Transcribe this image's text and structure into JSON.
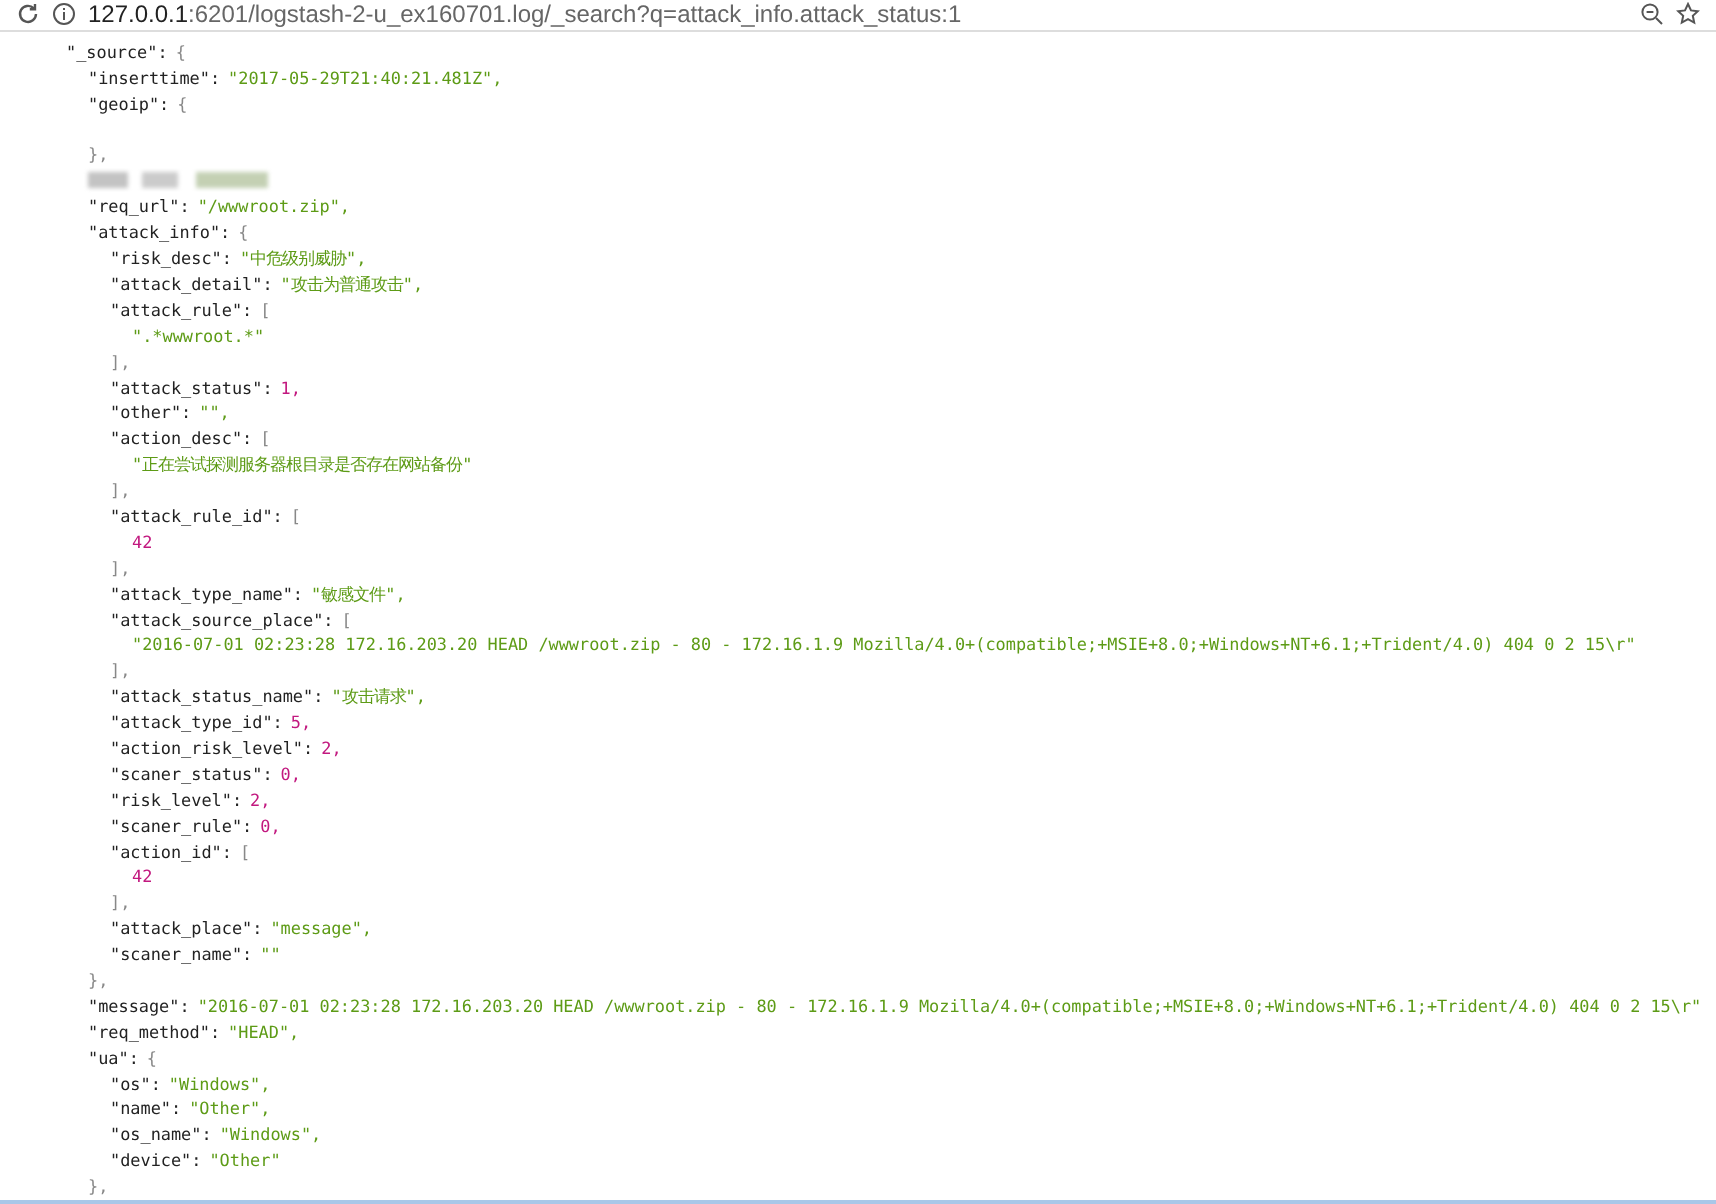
{
  "address_bar": {
    "host": "127.0.0.1",
    "path": ":6201/logstash-2-u_ex160701.log/_search?q=attack_info.attack_status:1"
  },
  "document": [
    {
      "kind": "object",
      "key": "\"_source\":",
      "open": "{",
      "children": [
        {
          "kind": "string",
          "key": "\"inserttime\":",
          "value": "\"2017-05-29T21:40:21.481Z\","
        },
        {
          "kind": "object",
          "key": "\"geoip\":",
          "open": "{",
          "close": "},",
          "children": [
            {
              "kind": "blank"
            }
          ]
        },
        {
          "kind": "redacted"
        },
        {
          "kind": "string",
          "key": "\"req_url\":",
          "value": "\"/wwwroot.zip\","
        },
        {
          "kind": "object",
          "key": "\"attack_info\":",
          "open": "{",
          "close": "},",
          "children": [
            {
              "kind": "string",
              "key": "\"risk_desc\":",
              "value": "\"中危级别威胁\","
            },
            {
              "kind": "string",
              "key": "\"attack_detail\":",
              "value": "\"攻击为普通攻击\","
            },
            {
              "kind": "object",
              "key": "\"attack_rule\":",
              "open": "[",
              "close": "],",
              "children": [
                {
                  "kind": "string",
                  "value": "\".*wwwroot.*\""
                }
              ]
            },
            {
              "kind": "number",
              "key": "\"attack_status\":",
              "value": "1,"
            },
            {
              "kind": "string",
              "key": "\"other\":",
              "value": "\"\","
            },
            {
              "kind": "object",
              "key": "\"action_desc\":",
              "open": "[",
              "close": "],",
              "children": [
                {
                  "kind": "string",
                  "value": "\"正在尝试探测服务器根目录是否存在网站备份\""
                }
              ]
            },
            {
              "kind": "object",
              "key": "\"attack_rule_id\":",
              "open": "[",
              "close": "],",
              "children": [
                {
                  "kind": "number",
                  "value": "42"
                }
              ]
            },
            {
              "kind": "string",
              "key": "\"attack_type_name\":",
              "value": "\"敏感文件\","
            },
            {
              "kind": "object",
              "key": "\"attack_source_place\":",
              "open": "[",
              "close": "],",
              "children": [
                {
                  "kind": "string",
                  "value": "\"2016-07-01 02:23:28 172.16.203.20 HEAD /wwwroot.zip - 80 - 172.16.1.9 Mozilla/4.0+(compatible;+MSIE+8.0;+Windows+NT+6.1;+Trident/4.0) 404 0 2 15\\r\""
                }
              ]
            },
            {
              "kind": "string",
              "key": "\"attack_status_name\":",
              "value": "\"攻击请求\","
            },
            {
              "kind": "number",
              "key": "\"attack_type_id\":",
              "value": "5,"
            },
            {
              "kind": "number",
              "key": "\"action_risk_level\":",
              "value": "2,"
            },
            {
              "kind": "number",
              "key": "\"scaner_status\":",
              "value": "0,"
            },
            {
              "kind": "number",
              "key": "\"risk_level\":",
              "value": "2,"
            },
            {
              "kind": "number",
              "key": "\"scaner_rule\":",
              "value": "0,"
            },
            {
              "kind": "object",
              "key": "\"action_id\":",
              "open": "[",
              "close": "],",
              "children": [
                {
                  "kind": "number",
                  "value": "42"
                }
              ]
            },
            {
              "kind": "string",
              "key": "\"attack_place\":",
              "value": "\"message\","
            },
            {
              "kind": "string",
              "key": "\"scaner_name\":",
              "value": "\"\""
            }
          ]
        },
        {
          "kind": "string",
          "key": "\"message\":",
          "value": "\"2016-07-01 02:23:28 172.16.203.20 HEAD /wwwroot.zip - 80 - 172.16.1.9 Mozilla/4.0+(compatible;+MSIE+8.0;+Windows+NT+6.1;+Trident/4.0) 404 0 2 15\\r\""
        },
        {
          "kind": "string",
          "key": "\"req_method\":",
          "value": "\"HEAD\","
        },
        {
          "kind": "object",
          "key": "\"ua\":",
          "open": "{",
          "close": "},",
          "children": [
            {
              "kind": "string",
              "key": "\"os\":",
              "value": "\"Windows\","
            },
            {
              "kind": "string",
              "key": "\"name\":",
              "value": "\"Other\","
            },
            {
              "kind": "string",
              "key": "\"os_name\":",
              "value": "\"Windows\","
            },
            {
              "kind": "string",
              "key": "\"device\":",
              "value": "\"Other\""
            }
          ]
        }
      ]
    }
  ]
}
